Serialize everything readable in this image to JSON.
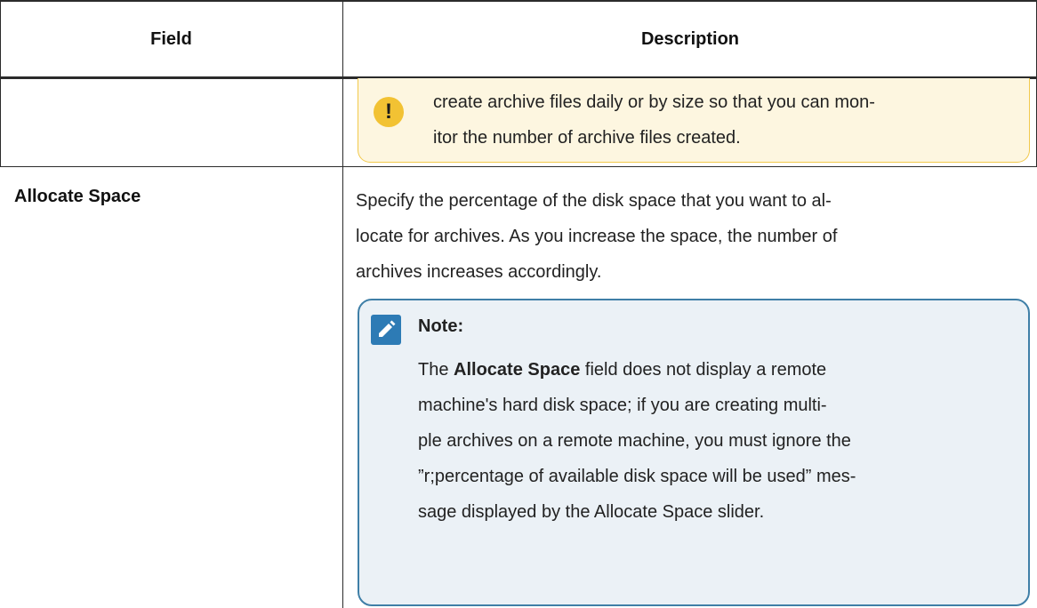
{
  "table": {
    "headers": {
      "field": "Field",
      "description": "Description"
    }
  },
  "warning": {
    "icon": "exclamation-icon",
    "line1": "create archive files daily or by size so that you can mon-",
    "line2": "itor the number of archive files created."
  },
  "row": {
    "field": "Allocate Space",
    "desc_line1": "Specify the percentage of the disk space that you want to al-",
    "desc_line2": "locate for archives. As you increase the space, the number of",
    "desc_line3": "archives increases accordingly."
  },
  "note": {
    "icon": "pencil-clipboard-icon",
    "title": "Note:",
    "intro": "The ",
    "bold": "Allocate Space",
    "line1_rest": " field does not display a remote",
    "line2": "machine's hard disk space; if you are creating multi-",
    "line3": "ple archives on a remote machine, you must ignore the",
    "line4": "”r;percentage of available disk space will be used” mes-",
    "line5": "sage displayed by the Allocate Space slider."
  },
  "colors": {
    "warning_bg": "#fdf6e0",
    "warning_border": "#f2c94c",
    "warning_icon": "#f2c233",
    "note_bg": "#ebf1f6",
    "note_border": "#3f7fa7",
    "note_icon": "#2d7bb5"
  }
}
